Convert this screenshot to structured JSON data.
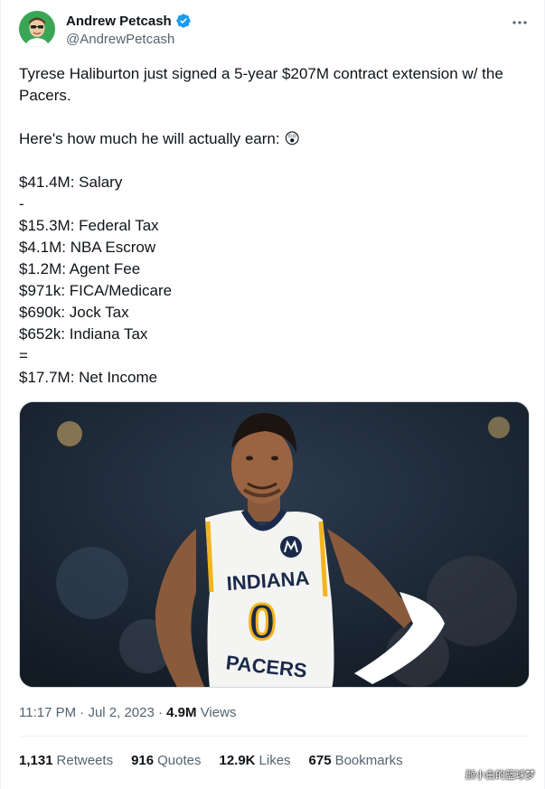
{
  "author": {
    "display_name": "Andrew Petcash",
    "handle": "@AndrewPetcash",
    "verified": true
  },
  "menu_icon": "more-horizontal-icon",
  "tweet": {
    "lines": [
      "Tyrese Haliburton just signed a 5-year $207M contract extension w/ the",
      "Pacers.",
      "",
      "Here's how much he will actually earn: 😲",
      "",
      "$41.4M: Salary",
      "-",
      "$15.3M: Federal Tax",
      "$4.1M: NBA Escrow",
      "$1.2M: Agent Fee",
      "$971k: FICA/Medicare",
      "$690k: Jock Tax",
      "$652k: Indiana Tax",
      "=",
      "$17.7M: Net Income"
    ]
  },
  "media": {
    "jersey_team": "INDIANA",
    "jersey_number": "0",
    "jersey_bottom": "PACERS"
  },
  "meta": {
    "time": "11:17 PM",
    "separator": "·",
    "date": "Jul 2, 2023",
    "dot": "·",
    "views_count": "4.9M",
    "views_label": "Views"
  },
  "stats": [
    {
      "count": "1,131",
      "label": "Retweets"
    },
    {
      "count": "916",
      "label": "Quotes"
    },
    {
      "count": "12.9K",
      "label": "Likes"
    },
    {
      "count": "675",
      "label": "Bookmarks"
    }
  ],
  "watermark": "颜小白的篮球梦",
  "colors": {
    "text": "#0f1419",
    "secondary": "#536471",
    "verified": "#1d9bf0",
    "jersey_navy": "#1b2a4a",
    "jersey_gold": "#f2b51e"
  }
}
